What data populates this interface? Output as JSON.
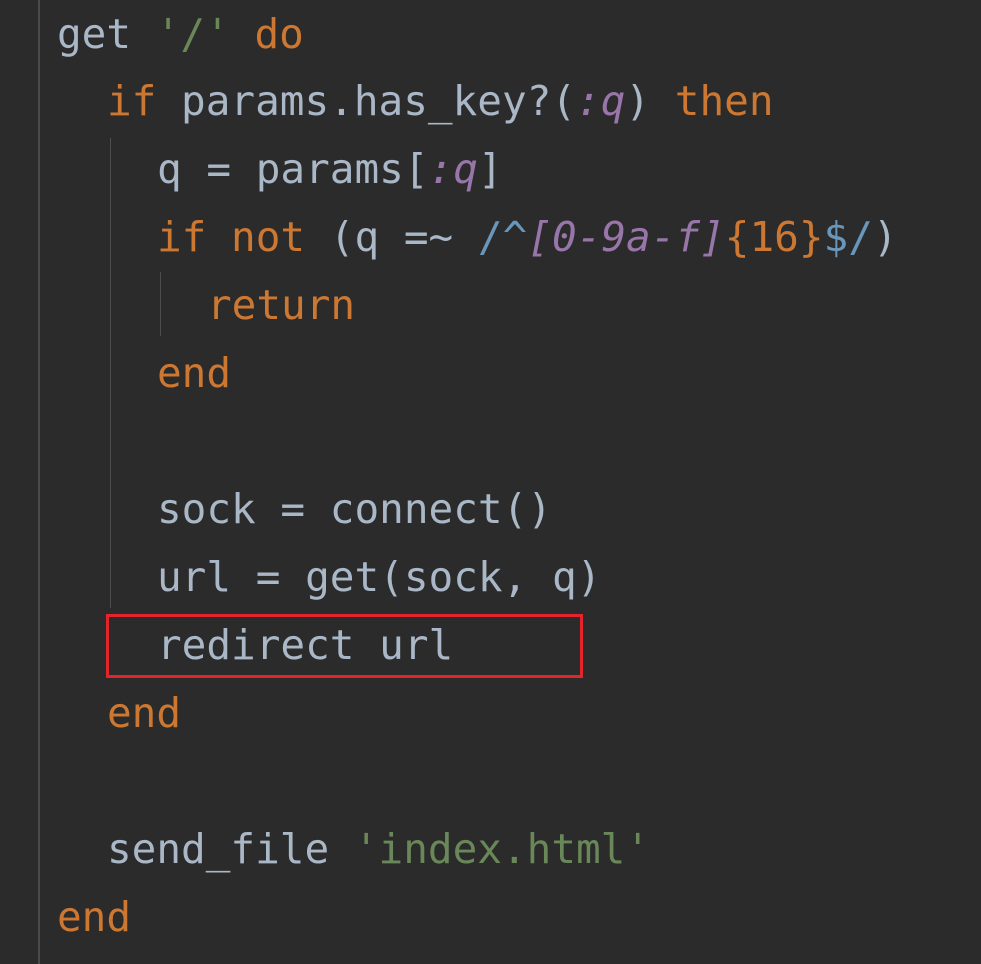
{
  "editor": {
    "lines": [
      {
        "tokens": [
          {
            "t": "get ",
            "c": "plain"
          },
          {
            "t": "'/'",
            "c": "str"
          },
          {
            "t": " do",
            "c": "kw"
          }
        ]
      },
      {
        "tokens": [
          {
            "t": "if",
            "c": "kw"
          },
          {
            "t": " params.has_key?(",
            "c": "plain"
          },
          {
            "t": ":q",
            "c": "sym"
          },
          {
            "t": ") ",
            "c": "plain"
          },
          {
            "t": "then",
            "c": "kw"
          }
        ]
      },
      {
        "tokens": [
          {
            "t": "q = params[",
            "c": "plain"
          },
          {
            "t": ":q",
            "c": "sym"
          },
          {
            "t": "]",
            "c": "plain"
          }
        ]
      },
      {
        "tokens": [
          {
            "t": "if not",
            "c": "kw"
          },
          {
            "t": " (q =~ ",
            "c": "plain"
          },
          {
            "t": "/^",
            "c": "re"
          },
          {
            "t": "[0-9a-f]",
            "c": "re-cls"
          },
          {
            "t": "{16}",
            "c": "re-q"
          },
          {
            "t": "$/",
            "c": "re"
          },
          {
            "t": ")",
            "c": "plain"
          }
        ]
      },
      {
        "tokens": [
          {
            "t": "return",
            "c": "kw"
          }
        ]
      },
      {
        "tokens": [
          {
            "t": "end",
            "c": "kw"
          }
        ]
      },
      {
        "tokens": []
      },
      {
        "tokens": [
          {
            "t": "sock = connect()",
            "c": "plain"
          }
        ]
      },
      {
        "tokens": [
          {
            "t": "url = get(sock, q)",
            "c": "plain"
          }
        ]
      },
      {
        "tokens": [
          {
            "t": "redirect url",
            "c": "plain"
          }
        ]
      },
      {
        "tokens": [
          {
            "t": "end",
            "c": "kw"
          }
        ]
      },
      {
        "tokens": []
      },
      {
        "tokens": [
          {
            "t": "send_file ",
            "c": "plain"
          },
          {
            "t": "'index.html'",
            "c": "str"
          }
        ]
      },
      {
        "tokens": [
          {
            "t": "end",
            "c": "kw"
          }
        ]
      }
    ]
  }
}
